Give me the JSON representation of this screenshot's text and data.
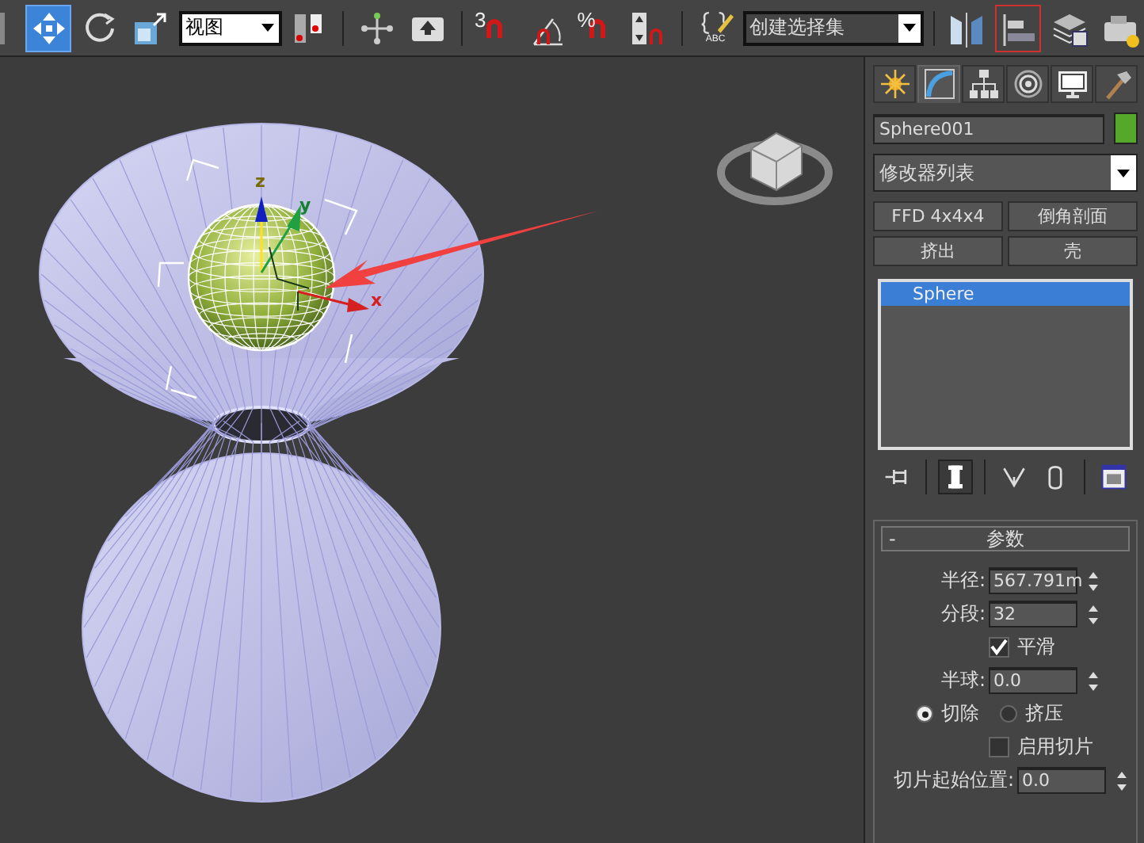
{
  "toolbar": [
    {
      "kind": "button",
      "selected": true
    },
    {
      "kind": "button",
      "selected": false
    },
    {
      "kind": "button",
      "selected": false
    },
    {
      "kind": "dropdown",
      "value": "视图"
    },
    {
      "kind": "button",
      "selected": false
    },
    {
      "kind": "sep"
    },
    {
      "kind": "button",
      "selected": false
    },
    {
      "kind": "button",
      "selected": false
    },
    {
      "kind": "sep"
    },
    {
      "kind": "button",
      "label": "3",
      "selected": false
    },
    {
      "kind": "button",
      "selected": false
    },
    {
      "kind": "button",
      "label": "%",
      "selected": false
    },
    {
      "kind": "button",
      "selected": false
    },
    {
      "kind": "sep"
    },
    {
      "kind": "button",
      "label": "ABC",
      "selected": false
    },
    {
      "kind": "dropdown",
      "value": "创建选择集"
    },
    {
      "kind": "sep"
    },
    {
      "kind": "button",
      "selected": false
    },
    {
      "kind": "button",
      "selected": true
    },
    {
      "kind": "button",
      "selected": false
    },
    {
      "kind": "button",
      "selected": false
    }
  ],
  "viewport": {
    "gizmo_axes": [
      {
        "label": "x"
      },
      {
        "label": "y"
      },
      {
        "label": "z"
      }
    ]
  },
  "command_tabs": [
    {
      "selected": false
    },
    {
      "selected": true
    },
    {
      "selected": false
    },
    {
      "selected": false
    },
    {
      "selected": false
    },
    {
      "selected": false
    }
  ],
  "object": {
    "name": "Sphere001",
    "color": "#55a82a"
  },
  "modifier_list": {
    "value": "修改器列表"
  },
  "modifier_buttons": [
    "FFD 4x4x4",
    "倒角剖面",
    "挤出",
    "壳"
  ],
  "stack": [
    {
      "label": "Sphere",
      "selected": true
    }
  ],
  "stack_tools": [
    {
      "selected": false
    },
    {
      "selected": true
    },
    {
      "selected": false
    },
    {
      "selected": false
    },
    {
      "selected": false
    }
  ],
  "rollout": {
    "title": "参数",
    "toggle": "-",
    "fields": [
      {
        "kind": "spinner",
        "label": "半径:",
        "value": "567.791m"
      },
      {
        "kind": "spinner",
        "label": "分段:",
        "value": "32"
      },
      {
        "kind": "checkbox",
        "label": "平滑",
        "checked": true
      },
      {
        "kind": "spinner",
        "label": "半球:",
        "value": "0.0"
      },
      {
        "kind": "radio",
        "options": [
          {
            "label": "切除",
            "selected": true
          },
          {
            "label": "挤压",
            "selected": false
          }
        ]
      },
      {
        "kind": "checkbox",
        "label": "启用切片",
        "checked": false
      },
      {
        "kind": "spinner",
        "label": "切片起始位置:",
        "value": "0.0"
      }
    ]
  }
}
